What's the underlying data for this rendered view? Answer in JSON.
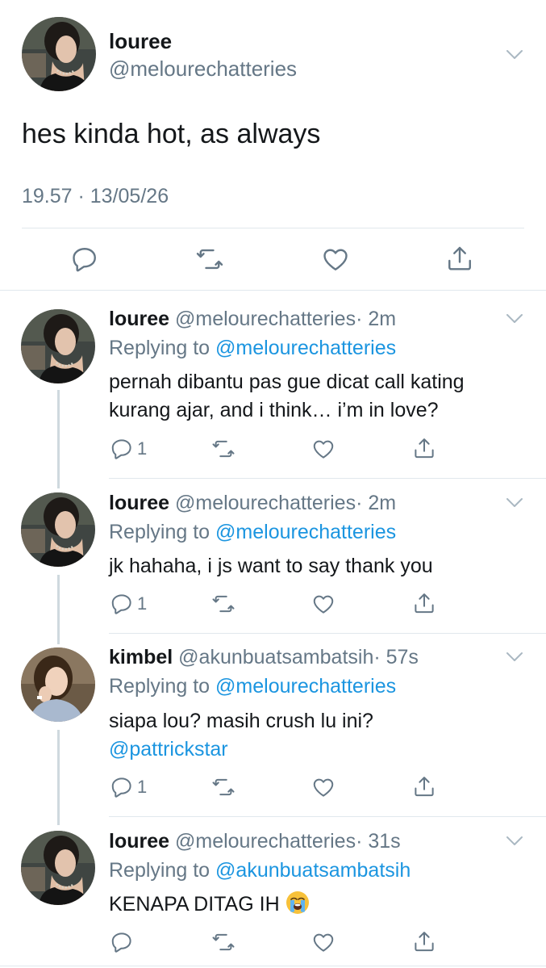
{
  "main_tweet": {
    "name": "louree",
    "handle": "@melourechatteries",
    "text": "hes kinda hot, as always",
    "timestamp": "19.57 · 13/05/26",
    "actions": [
      "reply-icon",
      "retweet-icon",
      "like-icon",
      "share-icon"
    ]
  },
  "replies": [
    {
      "name": "louree",
      "handle": "@melourechatteries",
      "time": "· 2m",
      "replying_prefix": "Replying to ",
      "replying_to": "@melourechatteries",
      "line1": "pernah dibantu pas gue dicat call kating",
      "line2": "kurang ajar, and i think… i’m in love?",
      "reply_count": "1"
    },
    {
      "name": "louree",
      "handle": "@melourechatteries",
      "time": "· 2m",
      "replying_prefix": "Replying to ",
      "replying_to": "@melourechatteries",
      "line1": "jk hahaha, i js want to say thank you",
      "reply_count": "1"
    },
    {
      "name": "kimbel",
      "handle": "@akunbuatsambatsih",
      "time": "· 57s",
      "replying_prefix": "Replying to ",
      "replying_to": "@melourechatteries",
      "line1": "siapa lou? masih crush lu ini?",
      "line2": "@pattrickstar",
      "reply_count": "1"
    },
    {
      "name": "louree",
      "handle": "@melourechatteries",
      "time": "· 31s",
      "replying_prefix": "Replying to ",
      "replying_to": "@akunbuatsambatsih",
      "line1": "KENAPA DITAG IH",
      "line1_emoji": "loudly-crying-face-emoji",
      "reply_count": ""
    }
  ],
  "colors": {
    "text": "#14171a",
    "secondary": "#657786",
    "link": "#1b95e0",
    "divider": "#e1e8ed",
    "icon": "#657786",
    "thread_line": "#cfd9de"
  }
}
